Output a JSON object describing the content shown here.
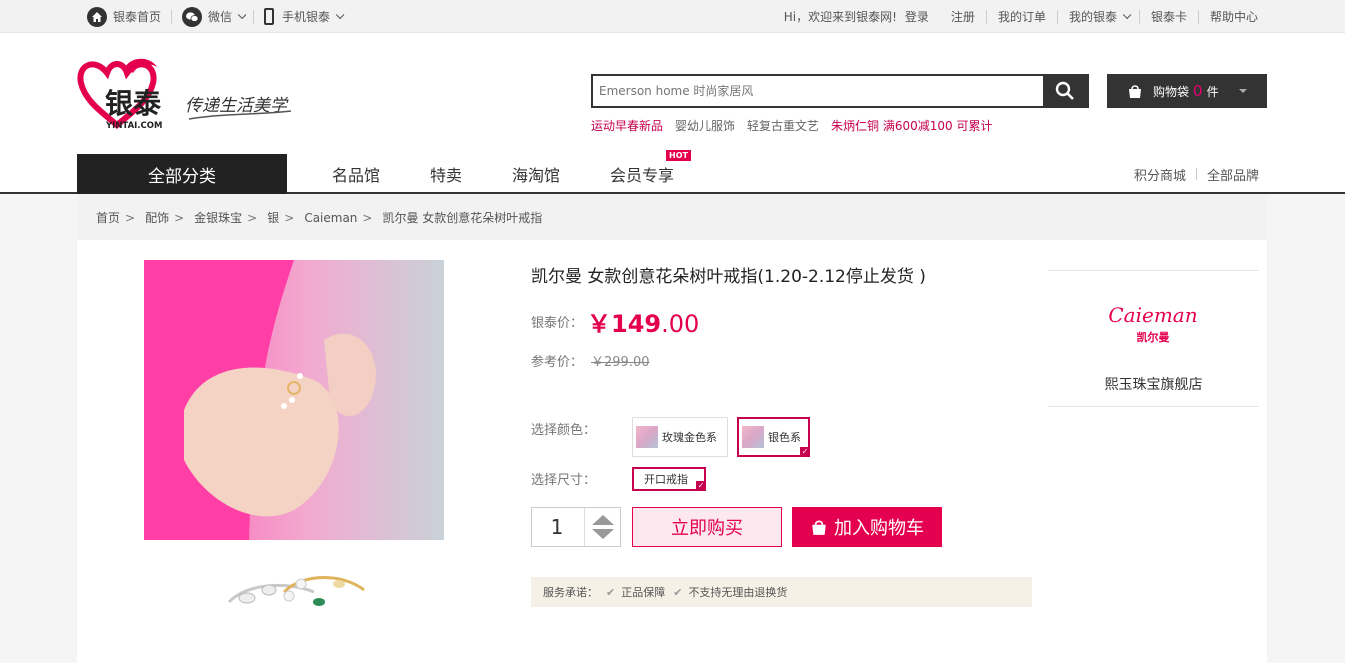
{
  "topbar": {
    "home": "银泰首页",
    "wechat": "微信",
    "mobile": "手机银泰",
    "welcome": "Hi，欢迎来到银泰网!",
    "login": "登录",
    "register": "注册",
    "orders": "我的订单",
    "my_yintai": "我的银泰",
    "card": "银泰卡",
    "help": "帮助中心"
  },
  "header": {
    "logo_text": "银泰",
    "logo_domain": "YINTAI.COM",
    "logo_slogan": "传递生活美学",
    "search_placeholder": "Emerson home 时尚家居风",
    "hotwords": [
      {
        "text": "运动早春新品",
        "highlight": true
      },
      {
        "text": "婴幼儿服饰",
        "highlight": false
      },
      {
        "text": "轻复古重文艺",
        "highlight": false
      },
      {
        "text": "朱炳仁铜 满600减100 可累计",
        "highlight": true
      }
    ],
    "cart_label": "购物袋",
    "cart_count": "0",
    "cart_unit": "件"
  },
  "nav": {
    "all_categories": "全部分类",
    "links": [
      "名品馆",
      "特卖",
      "海淘馆",
      "会员专享"
    ],
    "hot_badge": "HOT",
    "right": [
      "积分商城",
      "全部品牌"
    ]
  },
  "breadcrumb": [
    "首页",
    "配饰",
    "金银珠宝",
    "银",
    "Caieman",
    "凯尔曼 女款创意花朵树叶戒指"
  ],
  "product": {
    "title": "凯尔曼 女款创意花朵树叶戒指(1.20-2.12停止发货 )",
    "price_label": "银泰价：",
    "price_symbol": "￥",
    "price_int": "149",
    "price_dec": ".00",
    "ref_label": "参考价：",
    "ref_price": "￥299.00",
    "color_label": "选择颜色：",
    "colors": [
      "玫瑰金色系",
      "银色系"
    ],
    "size_label": "选择尺寸：",
    "size": "开口戒指",
    "quantity": "1",
    "buy_now": "立即购买",
    "add_cart": "加入购物车",
    "promise_label": "服务承诺：",
    "promises": [
      "正品保障",
      "不支持无理由退换货"
    ]
  },
  "shop": {
    "logo_en": "Caieman",
    "logo_cn": "凯尔曼",
    "name": "熙玉珠宝旗舰店"
  },
  "colors": {
    "brand": "#e4004f",
    "dark": "#333333",
    "accent": "#c7004f"
  }
}
